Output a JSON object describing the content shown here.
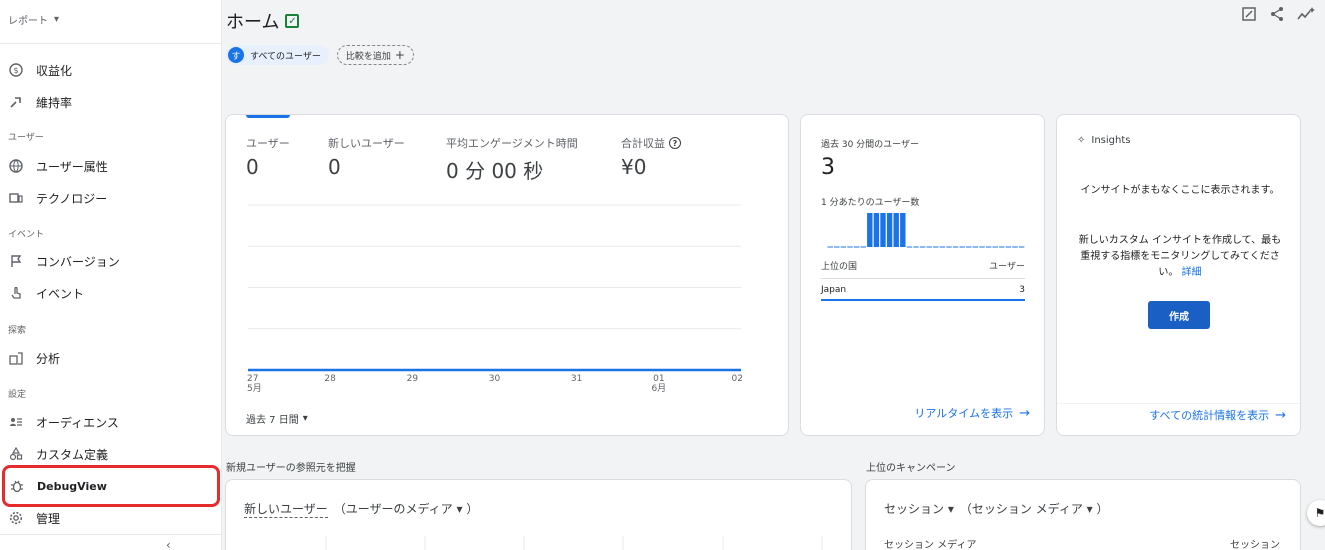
{
  "sidebar": {
    "report_label": "レポート",
    "items": [
      {
        "label": "収益化",
        "icon": "dollar-circle-icon"
      },
      {
        "label": "維持率",
        "icon": "retention-icon"
      }
    ],
    "sections": {
      "user": "ユーザー",
      "event": "イベント",
      "explore": "探索",
      "config": "設定"
    },
    "user_items": [
      {
        "label": "ユーザー属性",
        "icon": "globe-icon"
      },
      {
        "label": "テクノロジー",
        "icon": "devices-icon"
      }
    ],
    "event_items": [
      {
        "label": "コンバージョン",
        "icon": "flag-icon"
      },
      {
        "label": "イベント",
        "icon": "touch-icon"
      }
    ],
    "explore_items": [
      {
        "label": "分析",
        "icon": "analysis-icon"
      }
    ],
    "config_items": [
      {
        "label": "オーディエンス",
        "icon": "audience-icon"
      },
      {
        "label": "カスタム定義",
        "icon": "shapes-icon"
      },
      {
        "label": "DebugView",
        "icon": "bug-icon"
      }
    ],
    "admin": {
      "label": "管理",
      "icon": "gear-icon"
    }
  },
  "header": {
    "title": "ホーム",
    "chip_user_avatar": "す",
    "chip_user": "すべてのユーザー",
    "chip_add": "比較を追加"
  },
  "main_card": {
    "metrics": [
      {
        "label": "ユーザー",
        "value": "0"
      },
      {
        "label": "新しいユーザー",
        "value": "0"
      },
      {
        "label": "平均エンゲージメント時間",
        "value": "0 分 00 秒"
      },
      {
        "label": "合計収益",
        "value": "¥0"
      }
    ],
    "range": "過去 7 日間"
  },
  "chart_data": {
    "type": "line",
    "categories": [
      "27\n5月",
      "28",
      "29",
      "30",
      "31",
      "01\n6月",
      "02"
    ],
    "x": [
      "27",
      "28",
      "29",
      "30",
      "31",
      "01",
      "02"
    ],
    "x_month_labels": {
      "27": "5月",
      "01": "6月"
    },
    "series": [
      {
        "values": [
          0,
          0,
          0,
          0,
          0,
          0,
          0
        ]
      }
    ],
    "grid": true,
    "color": "#1a73e8"
  },
  "realtime": {
    "label": "過去 30 分間のユーザー",
    "value": "3",
    "sub": "1 分あたりのユーザー数",
    "bars": [
      0,
      0,
      0,
      0,
      0,
      0,
      1,
      1,
      1,
      1,
      1,
      1,
      0,
      0,
      0,
      0,
      0,
      0,
      0,
      0,
      0,
      0,
      0,
      0,
      0,
      0,
      0,
      0,
      0,
      0
    ],
    "col_country": "上位の国",
    "col_users": "ユーザー",
    "rows": [
      {
        "country": "Japan",
        "users": "3"
      }
    ],
    "link": "リアルタイムを表示"
  },
  "insights": {
    "title": "Insights",
    "text1": "インサイトがまもなくここに表示されます。",
    "text2": "新しいカスタム インサイトを作成して、最も重視する指標をモニタリングしてみてください。",
    "text2_link": "詳細",
    "button": "作成",
    "link": "すべての統計情報を表示"
  },
  "bottom": {
    "left_section": "新規ユーザーの参照元を把握",
    "right_section": "上位のキャンペーン",
    "left_dd_metric": "新しいユーザー",
    "left_dd_dim": "（ユーザーのメディア ▾ ）",
    "right_dd_metric": "セッション ▾",
    "right_dd_dim": "（セッション メディア ▾ ）",
    "right_col1": "セッション メディア",
    "right_col2": "セッション"
  }
}
